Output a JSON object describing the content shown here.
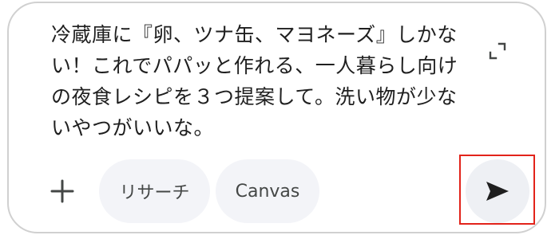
{
  "composer": {
    "prompt_text": "冷蔵庫に『卵、ツナ缶、マヨネーズ』しかない！これでパパッと作れる、一人暮らし向けの夜食レシピを３つ提案して。洗い物が少ないやつがいいな。"
  },
  "toolbar": {
    "add_icon": "plus-icon",
    "chips": [
      {
        "label": "リサーチ"
      },
      {
        "label": "Canvas"
      }
    ],
    "send_icon": "send-arrow-icon",
    "expand_icon": "expand-icon"
  },
  "colors": {
    "border": "#d0d0d0",
    "chip_background": "#f3f4f8",
    "send_background": "#eef0f4",
    "text": "#1f1f1f",
    "highlight": "#e2231a"
  }
}
